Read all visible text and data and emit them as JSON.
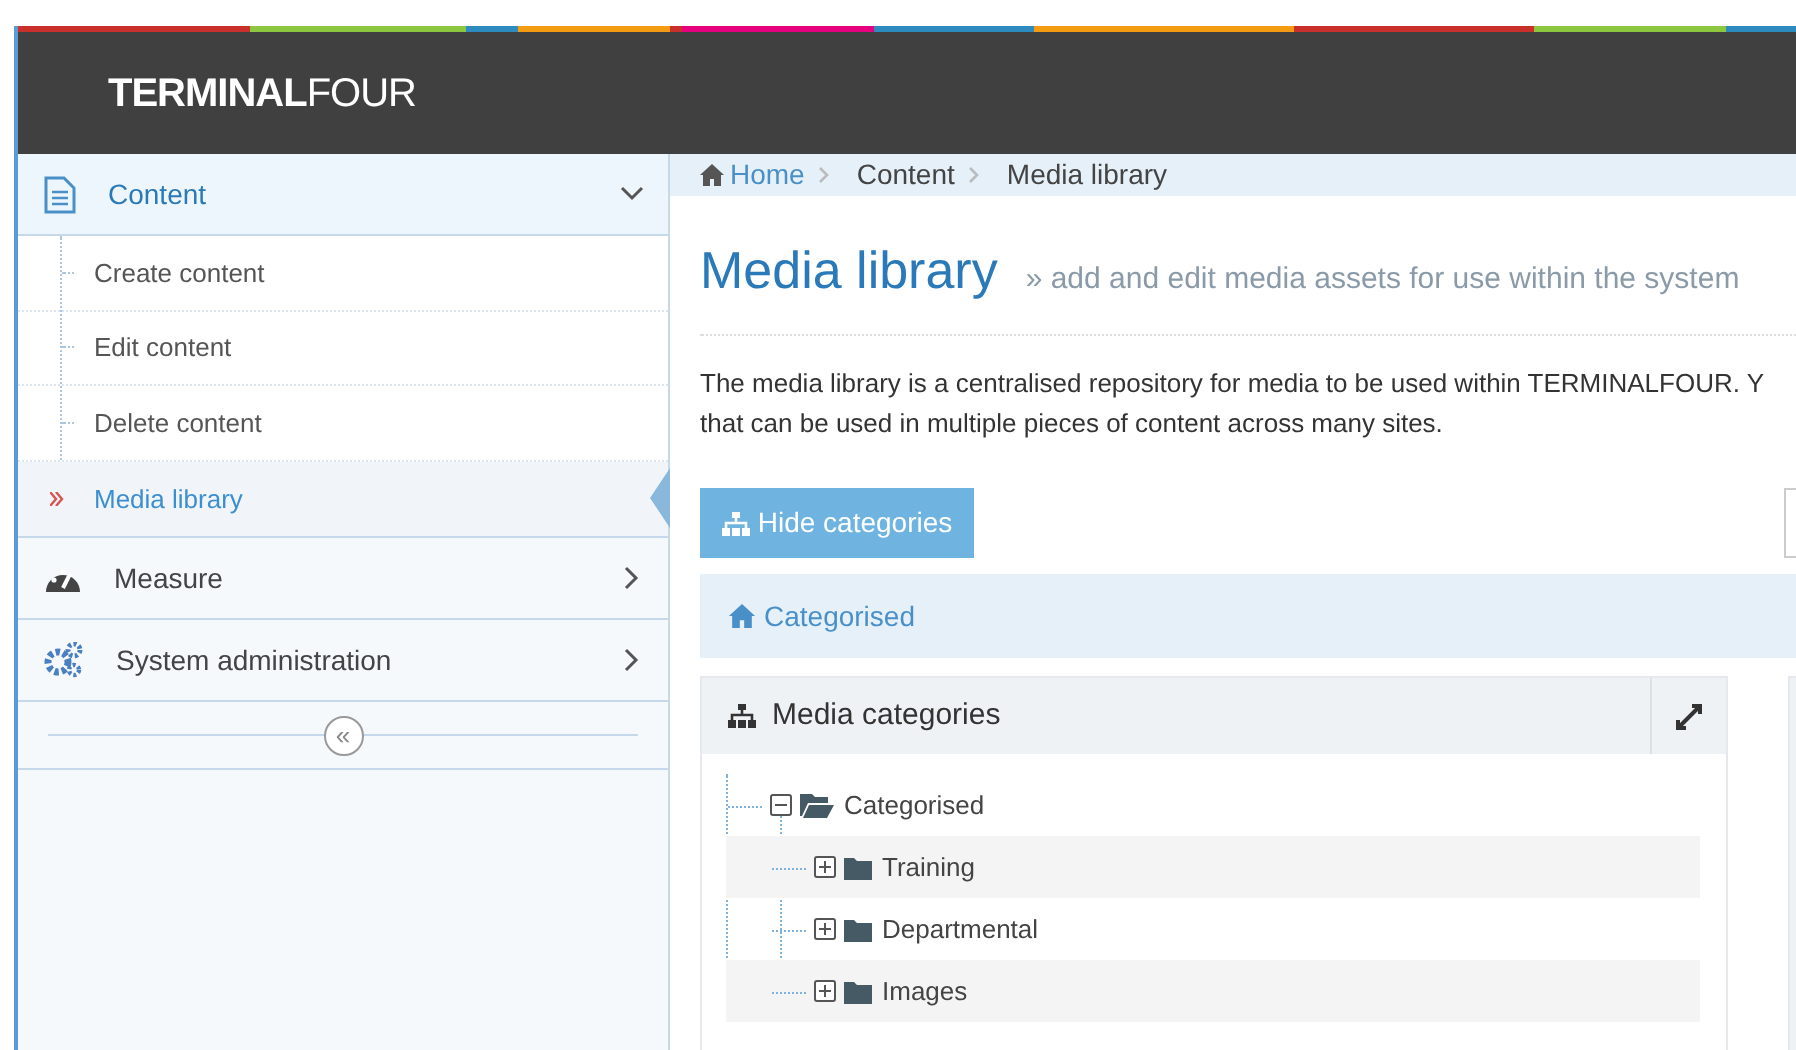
{
  "header": {
    "logo_bold": "TERMINAL",
    "logo_light": "FOUR"
  },
  "sidebar": {
    "sections": [
      {
        "label": "Content",
        "kind": "document",
        "expanded": true,
        "items": [
          {
            "label": "Create content",
            "selected": false
          },
          {
            "label": "Edit content",
            "selected": false
          },
          {
            "label": "Delete content",
            "selected": false
          },
          {
            "label": "Media library",
            "selected": true
          }
        ]
      },
      {
        "label": "Measure",
        "kind": "gauge",
        "expanded": false
      },
      {
        "label": "System administration",
        "kind": "gears",
        "expanded": false
      }
    ],
    "collapse_glyph": "«"
  },
  "breadcrumb": [
    {
      "label": "Home",
      "kind": "link"
    },
    {
      "label": "Content",
      "kind": "text"
    },
    {
      "label": "Media library",
      "kind": "text"
    }
  ],
  "page": {
    "title": "Media library",
    "subtitle": "» add and edit media assets for use within the system",
    "description_lines": [
      "The media library is a centralised repository for media to be used within TERMINALFOUR. Y",
      "that can be used in multiple pieces of content across many sites."
    ]
  },
  "hide_button": "Hide categories",
  "category_path": "Categorised",
  "panel": {
    "title": "Media categories",
    "tree": [
      {
        "label": "Categorised",
        "expanded": true,
        "children": [
          {
            "label": "Training",
            "expanded": false
          },
          {
            "label": "Departmental",
            "expanded": false
          },
          {
            "label": "Images",
            "expanded": false
          }
        ]
      }
    ]
  }
}
